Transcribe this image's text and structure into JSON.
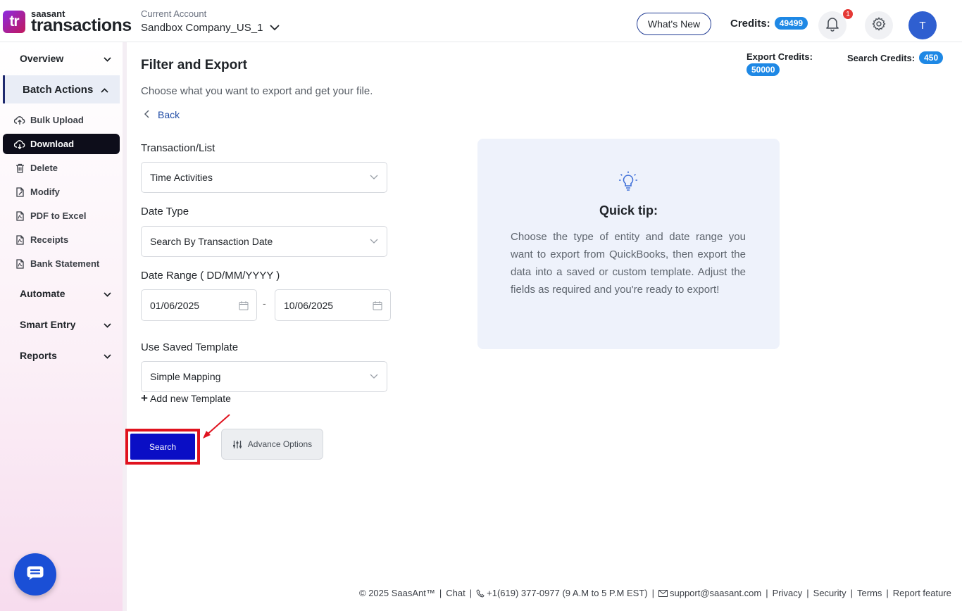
{
  "header": {
    "brand": "saasant",
    "product": "transactions",
    "logo_mark": "tr",
    "account_label": "Current Account",
    "account_name": "Sandbox Company_US_1",
    "whats_new": "What's New",
    "credits_label": "Credits:",
    "credits_value": "49499",
    "notification_count": "1",
    "avatar_initial": "T"
  },
  "sidebar": {
    "overview": "Overview",
    "batch_actions": "Batch Actions",
    "items": [
      {
        "label": "Bulk Upload",
        "icon": "cloud-upload-icon"
      },
      {
        "label": "Download",
        "icon": "cloud-download-icon"
      },
      {
        "label": "Delete",
        "icon": "trash-icon"
      },
      {
        "label": "Modify",
        "icon": "edit-file-icon"
      },
      {
        "label": "PDF to Excel",
        "icon": "pdf-icon"
      },
      {
        "label": "Receipts",
        "icon": "pdf-icon"
      },
      {
        "label": "Bank Statement",
        "icon": "pdf-icon"
      }
    ],
    "automate": "Automate",
    "smart_entry": "Smart Entry",
    "reports": "Reports"
  },
  "main": {
    "title": "Filter and Export",
    "subtitle": "Choose what you want to export and get your file.",
    "back": "Back",
    "export_credits_label": "Export Credits:",
    "export_credits_value": "50000",
    "search_credits_label": "Search Credits:",
    "search_credits_value": "450",
    "transaction_label": "Transaction/List",
    "transaction_value": "Time Activities",
    "date_type_label": "Date Type",
    "date_type_value": "Search By Transaction Date",
    "date_range_label": "Date Range ( DD/MM/YYYY )",
    "date_from": "01/06/2025",
    "date_sep": "-",
    "date_to": "10/06/2025",
    "template_label": "Use Saved Template",
    "template_value": "Simple Mapping",
    "add_template": "Add new Template",
    "search_button": "Search",
    "advance_button": "Advance Options"
  },
  "tip": {
    "title": "Quick tip:",
    "text": "Choose the type of entity and date range you want to export from QuickBooks, then export the data into a saved or custom template. Adjust the fields as required and you're ready to export!"
  },
  "footer": {
    "copyright": "© 2025 SaasAnt™",
    "chat": "Chat",
    "phone": "+1(619) 377-0977 (9 A.M to 5 P.M EST)",
    "email": "support@saasant.com",
    "privacy": "Privacy",
    "security": "Security",
    "terms": "Terms",
    "report": "Report feature"
  },
  "colors": {
    "accent_blue": "#1e88e5",
    "search_button": "#0a0ec5",
    "highlight_red": "#e0121e",
    "tip_background": "#eef2fb"
  }
}
